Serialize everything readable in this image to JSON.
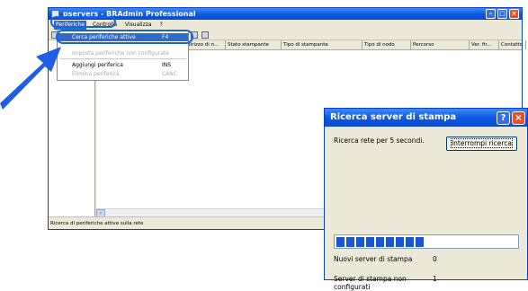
{
  "window": {
    "title": "pservers - BRAdmin Professional"
  },
  "menubar": {
    "items": [
      "Periferiche",
      "Controlla",
      "Visualizza",
      "?"
    ]
  },
  "dropdown": {
    "items": [
      {
        "label": "Cerca periferiche attive",
        "shortcut": "F4",
        "state": "highlighted"
      },
      {
        "label": "Imposta periferiche non configurate",
        "shortcut": "",
        "state": "disabled"
      },
      {
        "label": "Aggiungi periferica",
        "shortcut": "INS",
        "state": "normal"
      },
      {
        "label": "Elimina periferica",
        "shortcut": "CANC",
        "state": "disabled"
      }
    ]
  },
  "list": {
    "columns": [
      "Indirizzo di n...",
      "Stato stampante",
      "Tipo di stampante",
      "Tipo di nodo",
      "Percorso",
      "Ver. fir...",
      "Contatto"
    ]
  },
  "statusbar": {
    "text": "Ricerca di periferiche attive sulla rete"
  },
  "dialog": {
    "title": "Ricerca server di stampa",
    "searching_text": "Ricerca rete per 5 secondi.",
    "stop_button": "Interrompi ricerca",
    "progress": 0.45,
    "new_servers_label": "Nuovi server di stampa",
    "new_servers_value": "0",
    "unconfigured_label": "Server di stampa non configurati",
    "unconfigured_value": "1"
  },
  "colors": {
    "titlebar": "#0c56e0",
    "highlight": "#316ac5",
    "arrow": "#1e5fe6"
  }
}
